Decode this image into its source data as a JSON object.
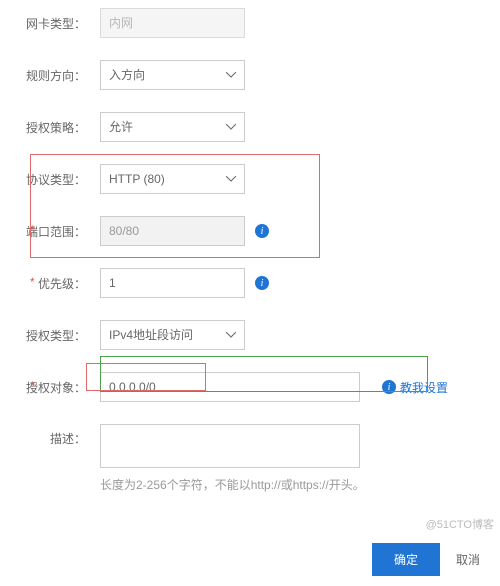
{
  "fields": {
    "nic_type": {
      "label": "网卡类型：",
      "value": "内网"
    },
    "direction": {
      "label": "规则方向：",
      "value": "入方向"
    },
    "policy": {
      "label": "授权策略：",
      "value": "允许"
    },
    "protocol": {
      "label": "协议类型：",
      "value": "HTTP (80)"
    },
    "port_range": {
      "label": "端口范围：",
      "value": "80/80"
    },
    "priority": {
      "label": "优先级：",
      "value": "1"
    },
    "auth_type": {
      "label": "授权类型：",
      "value": "IPv4地址段访问"
    },
    "auth_target": {
      "label": "授权对象：",
      "value": "0.0.0.0/0",
      "help": "教我设置"
    },
    "description": {
      "label": "描述：",
      "hint": "长度为2-256个字符，不能以http://或https://开头。"
    }
  },
  "buttons": {
    "ok": "确定",
    "cancel": "取消"
  },
  "watermark": "@51CTO博客"
}
